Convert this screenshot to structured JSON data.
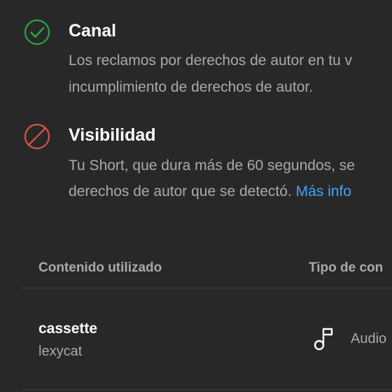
{
  "sections": [
    {
      "status": "ok",
      "icon": "check-circle-icon",
      "color": "#2ba640",
      "title": "Canal",
      "lines": [
        "Los reclamos por derechos de autor en tu v",
        "incumplimiento de derechos de autor."
      ]
    },
    {
      "status": "blocked",
      "icon": "blocked-circle-icon",
      "color": "#e15241",
      "title": "Visibilidad",
      "lines": [
        "Tu Short, que dura más de 60 segundos, se",
        "derechos de autor que se detectó."
      ],
      "link": "Más info"
    }
  ],
  "table": {
    "headers": [
      "Contenido utilizado",
      "Tipo de con"
    ],
    "rows": [
      {
        "title": "cassette",
        "artist": "lexycat",
        "type_icon": "music-note-icon",
        "type": "Audio"
      }
    ]
  },
  "colors": {
    "background": "#282828",
    "link": "#3ea6ff",
    "secondary_text": "#aaaaaa",
    "divider": "#3f3f3f"
  }
}
